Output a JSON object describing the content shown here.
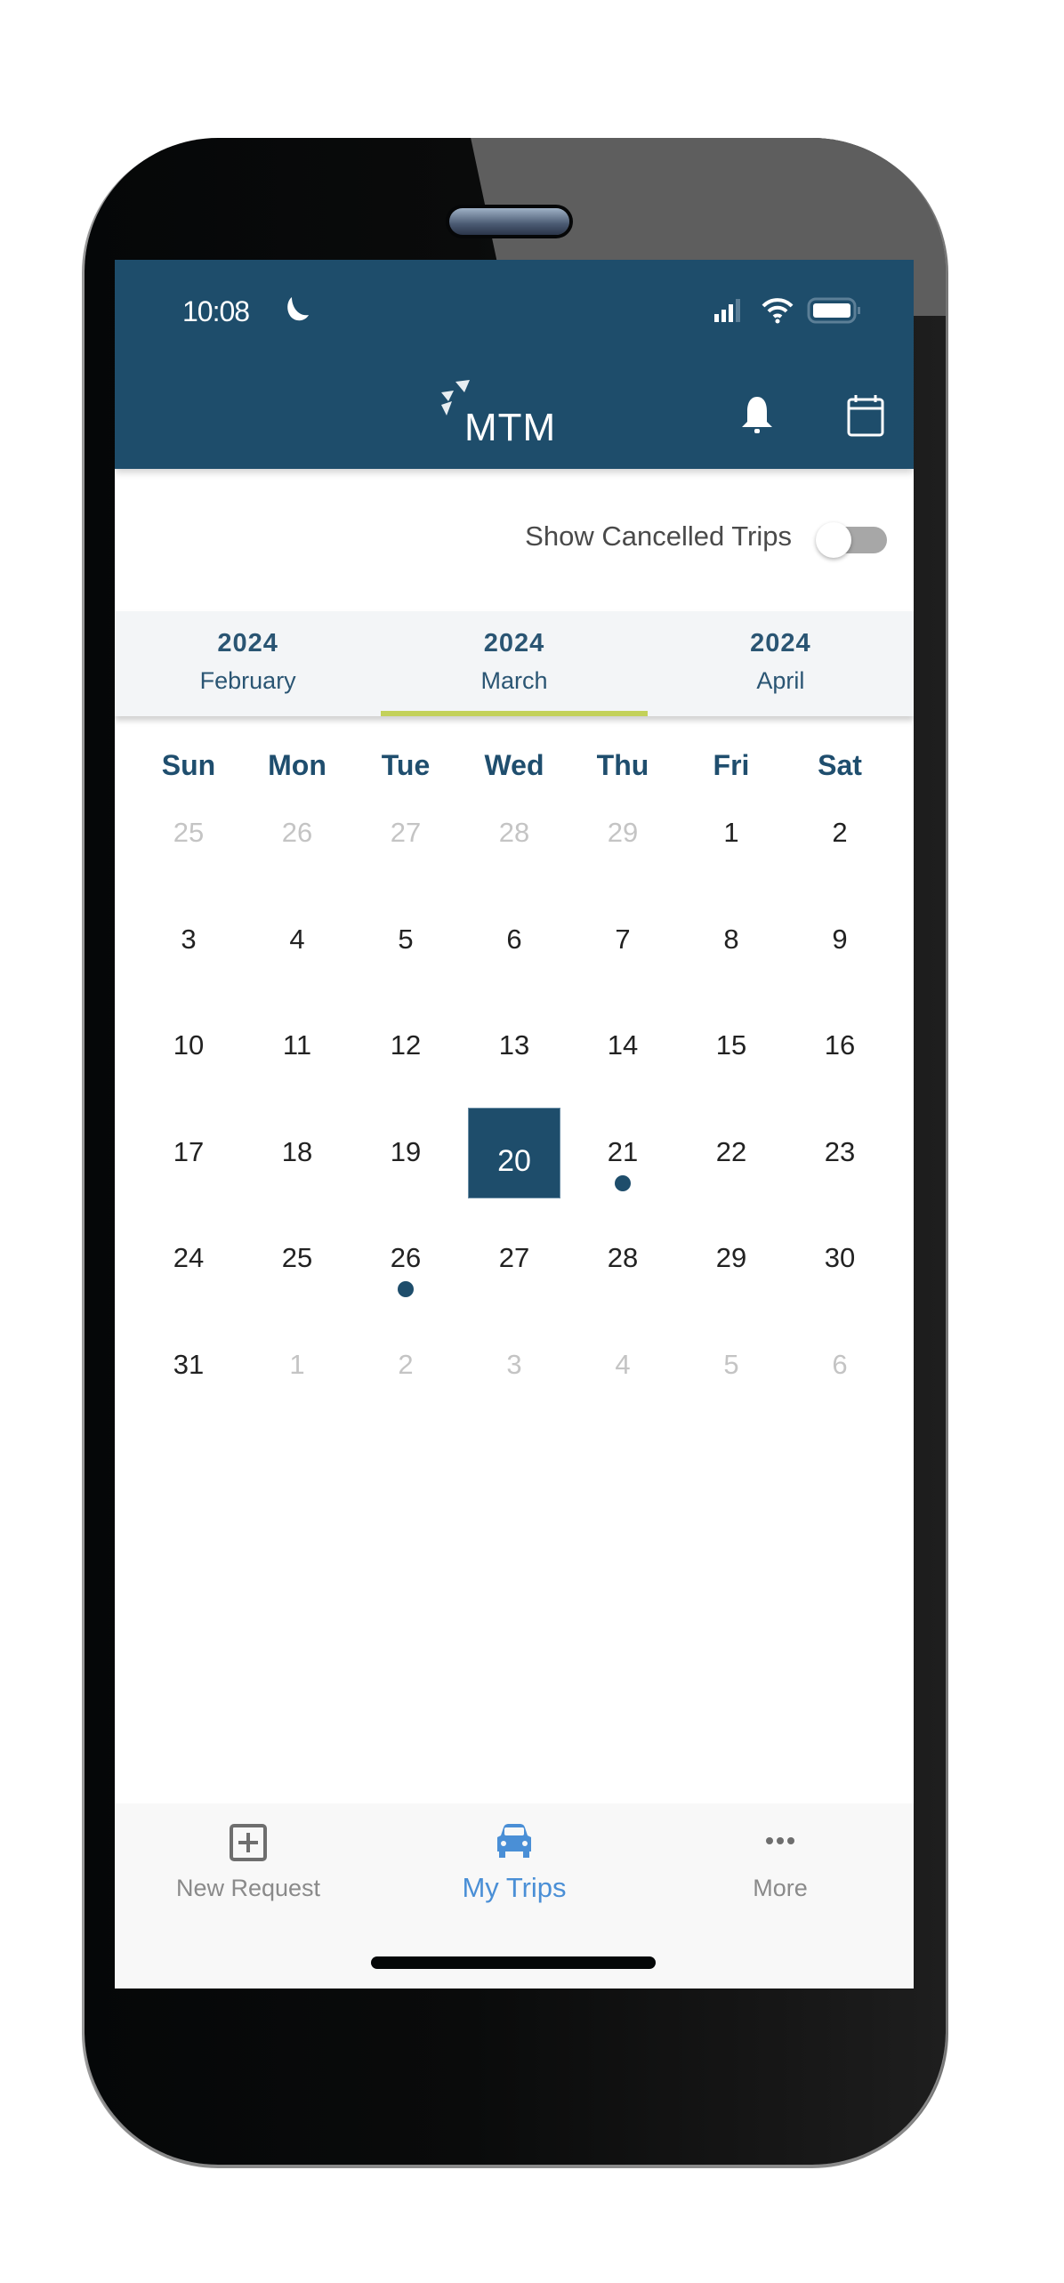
{
  "status_bar": {
    "time": "10:08",
    "icons": [
      "moon-icon",
      "signal-icon",
      "wifi-icon",
      "battery-icon"
    ]
  },
  "header": {
    "logo_text": "MTM",
    "icons": [
      "bell-icon",
      "calendar-icon"
    ]
  },
  "cancelled_toggle": {
    "label": "Show Cancelled Trips",
    "on": false
  },
  "month_tabs": [
    {
      "year": "2024",
      "month": "February",
      "active": false
    },
    {
      "year": "2024",
      "month": "March",
      "active": true
    },
    {
      "year": "2024",
      "month": "April",
      "active": false
    }
  ],
  "calendar": {
    "weekdays": [
      "Sun",
      "Mon",
      "Tue",
      "Wed",
      "Thu",
      "Fri",
      "Sat"
    ],
    "selected_day": "20",
    "weeks": [
      [
        {
          "d": "25",
          "other": true
        },
        {
          "d": "26",
          "other": true
        },
        {
          "d": "27",
          "other": true
        },
        {
          "d": "28",
          "other": true
        },
        {
          "d": "29",
          "other": true
        },
        {
          "d": "1"
        },
        {
          "d": "2"
        }
      ],
      [
        {
          "d": "3"
        },
        {
          "d": "4"
        },
        {
          "d": "5"
        },
        {
          "d": "6"
        },
        {
          "d": "7"
        },
        {
          "d": "8"
        },
        {
          "d": "9"
        }
      ],
      [
        {
          "d": "10"
        },
        {
          "d": "11"
        },
        {
          "d": "12"
        },
        {
          "d": "13"
        },
        {
          "d": "14"
        },
        {
          "d": "15"
        },
        {
          "d": "16"
        }
      ],
      [
        {
          "d": "17"
        },
        {
          "d": "18"
        },
        {
          "d": "19"
        },
        {
          "d": "20",
          "selected": true
        },
        {
          "d": "21",
          "trip": true
        },
        {
          "d": "22"
        },
        {
          "d": "23"
        }
      ],
      [
        {
          "d": "24"
        },
        {
          "d": "25"
        },
        {
          "d": "26",
          "trip": true
        },
        {
          "d": "27"
        },
        {
          "d": "28"
        },
        {
          "d": "29"
        },
        {
          "d": "30"
        }
      ],
      [
        {
          "d": "31"
        },
        {
          "d": "1",
          "other": true
        },
        {
          "d": "2",
          "other": true
        },
        {
          "d": "3",
          "other": true
        },
        {
          "d": "4",
          "other": true
        },
        {
          "d": "5",
          "other": true
        },
        {
          "d": "6",
          "other": true
        }
      ]
    ]
  },
  "tab_bar": {
    "items": [
      {
        "label": "New Request",
        "icon": "plus-square-icon",
        "active": false
      },
      {
        "label": "My Trips",
        "icon": "car-icon",
        "active": true
      },
      {
        "label": "More",
        "icon": "more-dots-icon",
        "active": false
      }
    ]
  },
  "colors": {
    "brand": "#1e4d6b",
    "accent_underline": "#c3d15a",
    "active_tab": "#4a8fd6"
  }
}
